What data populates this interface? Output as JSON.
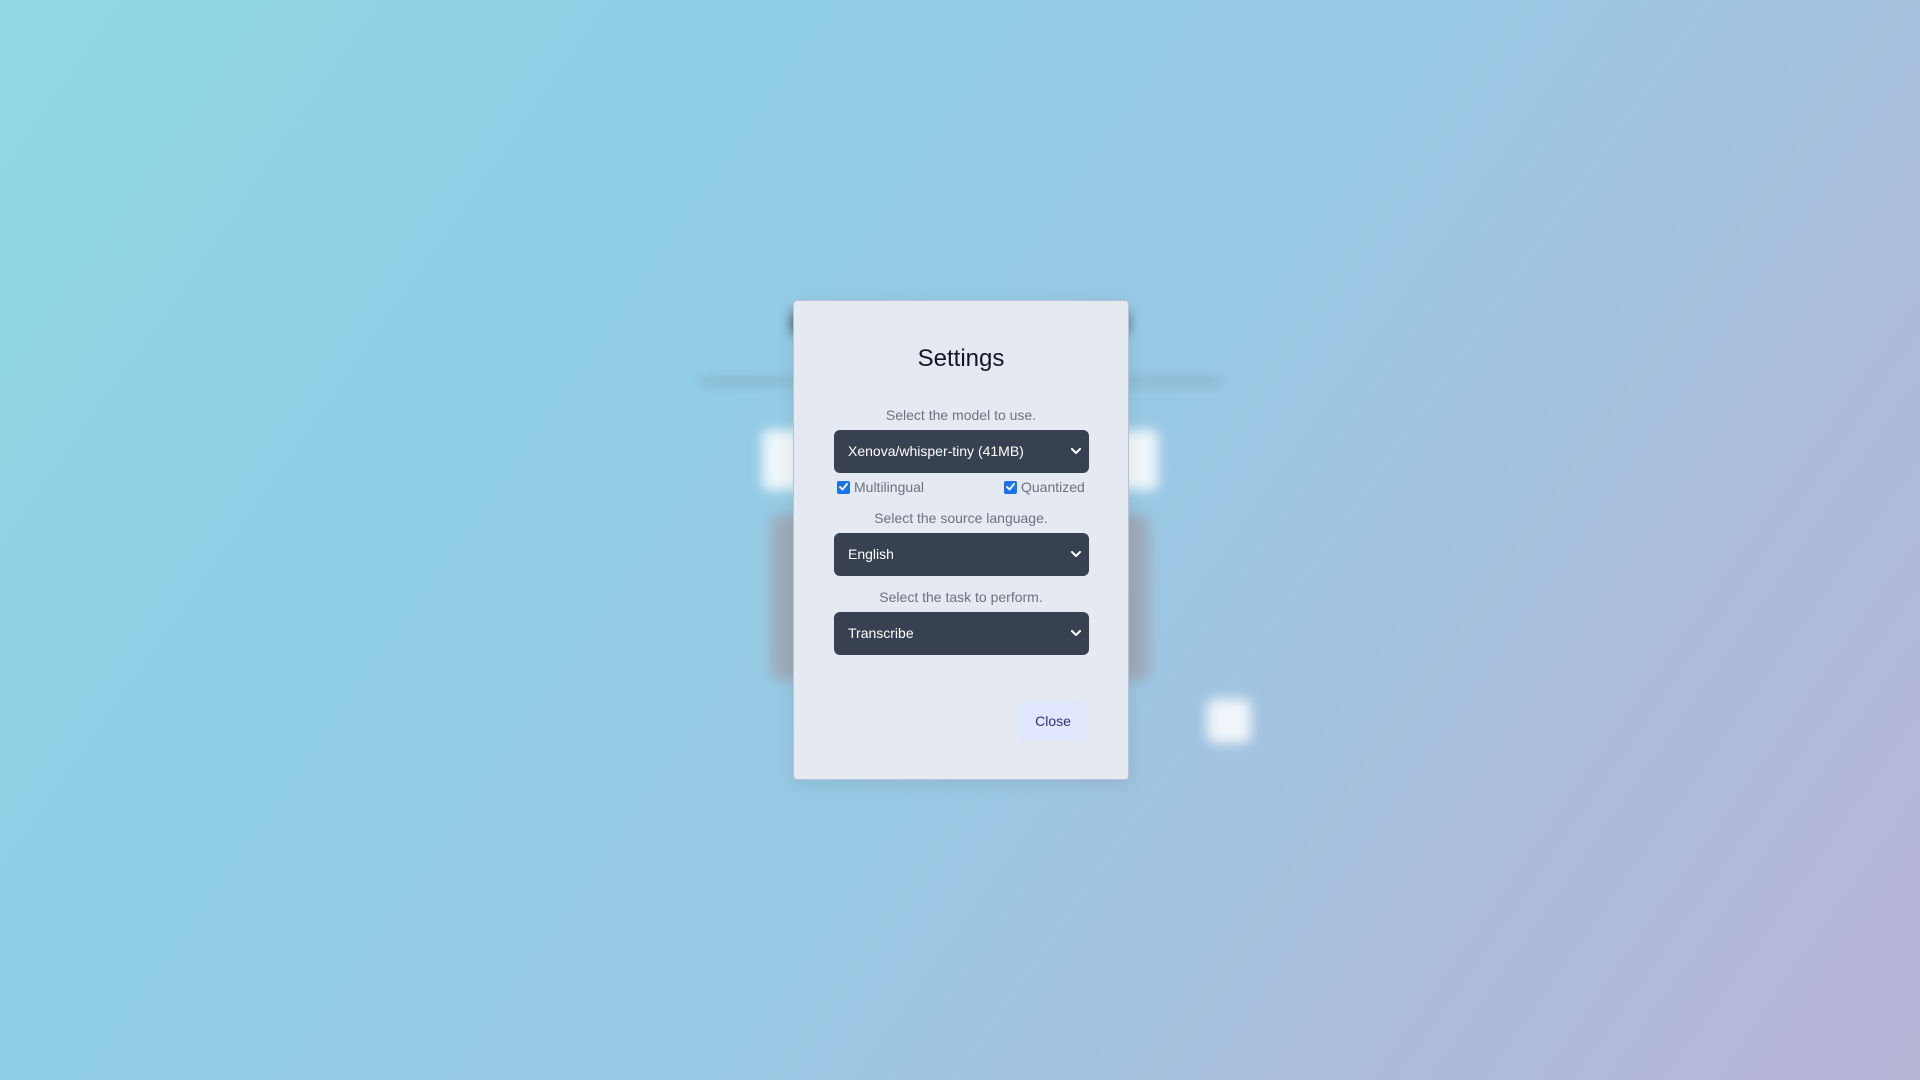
{
  "dialog": {
    "title": "Settings",
    "model_label": "Select the model to use.",
    "model_value": "Xenova/whisper-tiny (41MB)",
    "multilingual_label": "Multilingual",
    "multilingual_checked": true,
    "quantized_label": "Quantized",
    "quantized_checked": true,
    "language_label": "Select the source language.",
    "language_value": "English",
    "task_label": "Select the task to perform.",
    "task_value": "Transcribe",
    "close_label": "Close"
  },
  "colors": {
    "select_bg": "#374151",
    "checkbox_accent": "#1a73e8",
    "close_bg": "#e0e7ff",
    "dialog_bg": "#e5e9f2"
  },
  "icons": [
    "chevron-down-icon",
    "checkmark-icon"
  ]
}
